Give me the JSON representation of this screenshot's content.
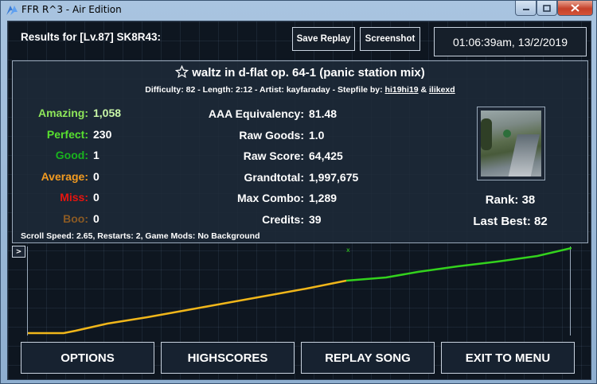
{
  "window": {
    "title": "FFR R^3 - Air Edition"
  },
  "header": {
    "results_title": "Results for [Lv.87] SK8R43:",
    "save_replay": "Save Replay",
    "screenshot": "Screenshot",
    "datetime": "01:06:39am, 13/2/2019"
  },
  "song": {
    "title": "waltz in d-flat op. 64-1 (panic station mix)",
    "meta_prefix": "Difficulty: 82 - Length: 2:12 - Artist: kayfaraday - Stepfile by: ",
    "stepper1": "hi19hi19",
    "amp": " & ",
    "stepper2": "ilikexd"
  },
  "judgements": [
    {
      "label": "Amazing:",
      "value": "1,058",
      "color": "#8ee65a"
    },
    {
      "label": "Perfect:",
      "value": "230",
      "color": "#58e02f"
    },
    {
      "label": "Good:",
      "value": "1",
      "color": "#19b31e"
    },
    {
      "label": "Average:",
      "value": "0",
      "color": "#f29b21"
    },
    {
      "label": "Miss:",
      "value": "0",
      "color": "#e8140f"
    },
    {
      "label": "Boo:",
      "value": "0",
      "color": "#8a5a24"
    }
  ],
  "stats": [
    {
      "label": "AAA Equivalency:",
      "value": "81.48"
    },
    {
      "label": "Raw Goods:",
      "value": "1.0"
    },
    {
      "label": "Raw Score:",
      "value": "64,425"
    },
    {
      "label": "Grandtotal:",
      "value": "1,997,675"
    },
    {
      "label": "Max Combo:",
      "value": "1,289"
    },
    {
      "label": "Credits:",
      "value": "39"
    }
  ],
  "rank": {
    "rank_text": "Rank: 38",
    "last_best_text": "Last Best: 82"
  },
  "footnote": "Scroll Speed: 2.65, Restarts: 2, Game Mods: No Background",
  "graph": {
    "toggle_label": ">"
  },
  "buttons": {
    "options": "OPTIONS",
    "highscores": "HIGHSCORES",
    "replay_song": "REPLAY SONG",
    "exit_to_menu": "EXIT TO MENU"
  },
  "colors": {
    "graph_early": "#f0b61a",
    "graph_late": "#33d21d"
  }
}
